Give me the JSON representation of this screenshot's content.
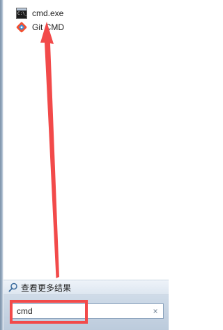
{
  "results": [
    {
      "label": "cmd.exe",
      "icon": "cmd-icon"
    },
    {
      "label": "Git CMD",
      "icon": "git-icon"
    }
  ],
  "see_more": {
    "label": "查看更多结果",
    "icon": "magnifier-icon"
  },
  "search": {
    "value": "cmd",
    "clear_glyph": "×"
  },
  "annotation": {
    "color": "#f24a4a"
  }
}
